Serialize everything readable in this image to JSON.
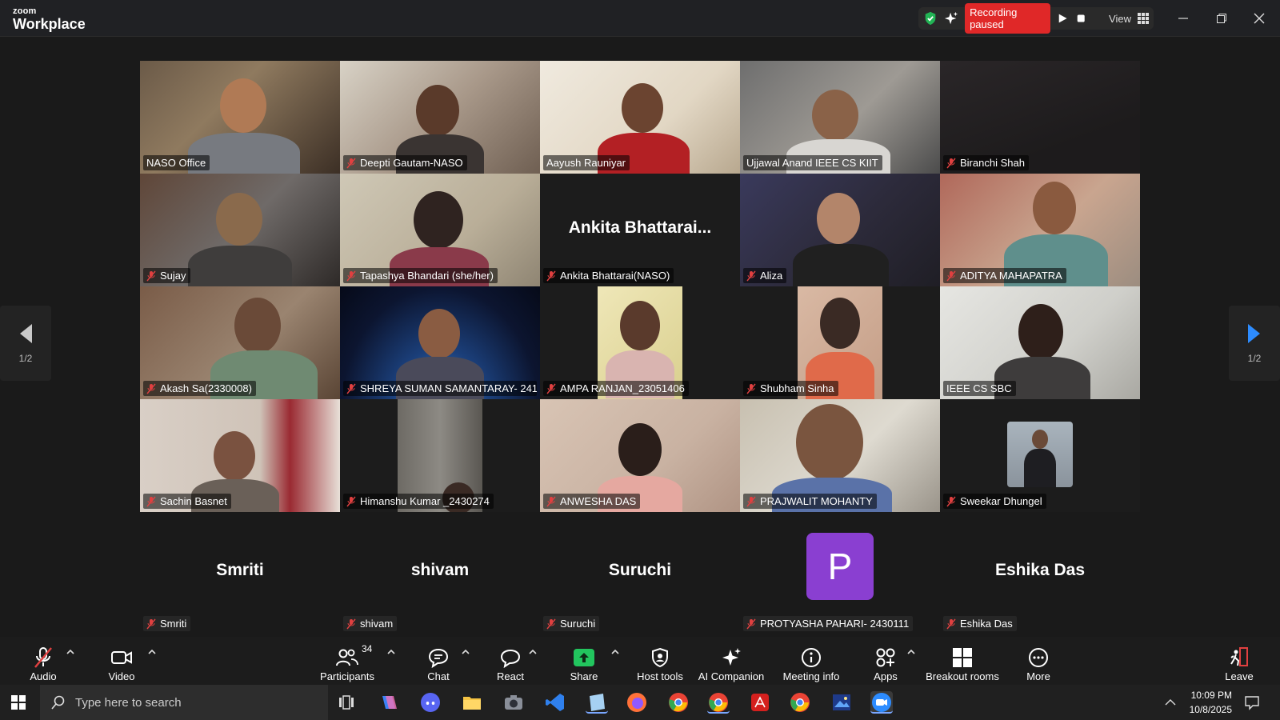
{
  "app": {
    "brand_small": "zoom",
    "brand_big": "Workplace"
  },
  "recording": {
    "status": "Recording paused",
    "view_label": "View"
  },
  "colors": {
    "accent_green": "#1fd37c",
    "record_red": "#e02828",
    "avatar_purple": "#8a3fd1",
    "mic_off": "#e04040"
  },
  "participants": [
    {
      "name": "NASO Office",
      "muted": false
    },
    {
      "name": "Deepti Gautam-NASO",
      "muted": true
    },
    {
      "name": "Aayush Rauniyar",
      "muted": false
    },
    {
      "name": "Ujjawal Anand IEEE CS KIIT",
      "muted": false
    },
    {
      "name": "Biranchi Shah",
      "muted": true
    },
    {
      "name": "Sujay",
      "muted": true
    },
    {
      "name": "Tapashya Bhandari (she/her)",
      "muted": true
    },
    {
      "name": "Ankita Bhattarai(NASO)",
      "muted": true,
      "display": "Ankita Bhattarai..."
    },
    {
      "name": "Aliza",
      "muted": true
    },
    {
      "name": "ADITYA MAHAPATRA",
      "muted": true
    },
    {
      "name": "Akash Sa(2330008)",
      "muted": true
    },
    {
      "name": "SHREYA SUMAN SAMANTARAY- 241...",
      "muted": true
    },
    {
      "name": "AMPA RANJAN_23051406",
      "muted": true
    },
    {
      "name": "Shubham Sinha",
      "muted": true
    },
    {
      "name": "IEEE CS SBC",
      "muted": false,
      "active": true
    },
    {
      "name": "Sachin Basnet",
      "muted": true
    },
    {
      "name": "Himanshu Kumar _2430274",
      "muted": true
    },
    {
      "name": "ANWESHA DAS",
      "muted": true
    },
    {
      "name": "PRAJWALIT MOHANTY",
      "muted": true
    },
    {
      "name": "Sweekar Dhungel",
      "muted": true
    }
  ],
  "no_video": [
    {
      "name": "Smriti",
      "display": "Smriti"
    },
    {
      "name": "shivam",
      "display": "shivam"
    },
    {
      "name": "Suruchi",
      "display": "Suruchi"
    },
    {
      "name": "PROTYASHA PAHARI- 2430111",
      "avatar_letter": "P"
    },
    {
      "name": "Eshika Das",
      "display": "Eshika Das"
    }
  ],
  "pagination": {
    "left": "1/2",
    "right": "1/2"
  },
  "toolbar": {
    "audio": "Audio",
    "video": "Video",
    "participants": "Participants",
    "participants_count": "34",
    "chat": "Chat",
    "react": "React",
    "share": "Share",
    "host_tools": "Host tools",
    "ai_companion": "AI Companion",
    "meeting_info": "Meeting info",
    "apps": "Apps",
    "breakout_rooms": "Breakout rooms",
    "more": "More",
    "leave": "Leave"
  },
  "taskbar": {
    "search_placeholder": "Type here to search",
    "time": "10:09 PM",
    "date": "10/8/2025"
  }
}
